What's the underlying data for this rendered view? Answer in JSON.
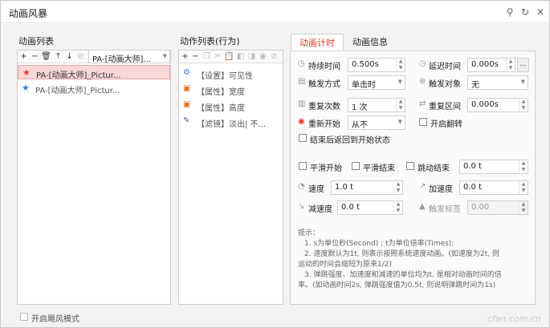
{
  "window": {
    "title": "动画风暴"
  },
  "left": {
    "label": "动画列表",
    "combo": "PA-[动画大师]...",
    "items": [
      {
        "name": "PA-[动画大师]_Pictur...",
        "selected": true
      },
      {
        "name": "PA-[动画大师]_Pictur...",
        "selected": false
      }
    ],
    "footer": "开启飓风模式"
  },
  "middle": {
    "label": "动作列表(行为)",
    "items": [
      "【设置】可见性",
      "【属性】宽度",
      "【属性】高度",
      "【滤镜】淡出| 不..."
    ]
  },
  "tabs": [
    "动画计时",
    "动画信息"
  ],
  "timing": {
    "duration_label": "持续时间",
    "duration": "0.500s",
    "delay_label": "延迟时间",
    "delay": "0.000s",
    "trigger_label": "触发方式",
    "trigger": "单击时",
    "trigger_obj_label": "触发对象",
    "trigger_obj": "无",
    "repeat_label": "重复次数",
    "repeat": "1 次",
    "repeat_interval_label": "重复区间",
    "repeat_interval": "0.000s",
    "restart_label": "重新开始",
    "restart": "从不",
    "flip_label": "开启翻转",
    "rewind_label": "结束后返回到开始状态",
    "smooth_start_label": "平滑开始",
    "smooth_end_label": "平滑结束",
    "bounce_end_label": "跳动结束",
    "bounce_end": "0.0 t",
    "speed_label": "速度",
    "speed": "1.0 t",
    "accel_label": "加速度",
    "accel": "0.0 t",
    "decel_label": "减速度",
    "decel": "0.0 t",
    "trigger_tag_label": "触发标签",
    "trigger_tag": "0.00",
    "ellipsis": "..."
  },
  "hint": {
    "title": "提示：",
    "lines": [
      "1. s为单位秒(Second) ;   t为单位倍率(Times);",
      "2. 速度默认为1t, 则表示按照系统速度动画。(如速度为2t, 则",
      "运动的时间会缩短为原来1/2)",
      "3. 弹跳强度、加速度和减速的单位均为t, 是相对动画时间的倍",
      "率。(如动画时间2s, 弹跳强度值为0.5t, 则说明弹跳时间为1s)"
    ]
  },
  "watermark": "cfan.com.cn"
}
